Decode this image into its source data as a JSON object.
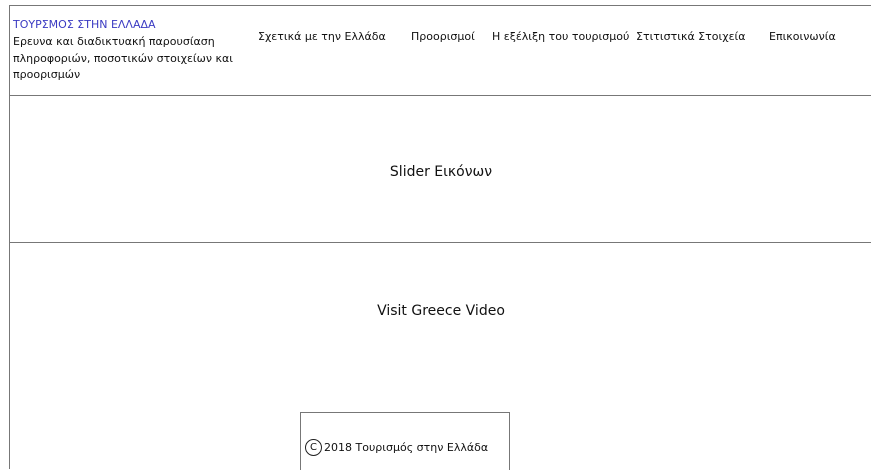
{
  "brand": {
    "title": "ΤΟΥΡΣΜΟΣ ΣΤΗΝ ΕΛΛΑΔΑ",
    "subtitle": "Ερευνα και διαδικτυακή παρουσίαση πληροφοριών, ποσοτικών στοιχείων και προορισμών"
  },
  "nav": {
    "items": [
      {
        "label": "Σχετικά με την Ελλάδα"
      },
      {
        "label": "Προορισμοί"
      },
      {
        "label": "Η εξέλιξη του τουρισμού"
      },
      {
        "label": "Στιτιστικά Στοιχεία"
      },
      {
        "label": "Επικοινωνία"
      }
    ]
  },
  "slider": {
    "label": "Slider Εικόνων"
  },
  "video": {
    "label": "Visit Greece Video"
  },
  "footer": {
    "icon": "copyright-icon",
    "icon_glyph": "C",
    "text": "2018 Τουρισμός στην Ελλάδα"
  }
}
